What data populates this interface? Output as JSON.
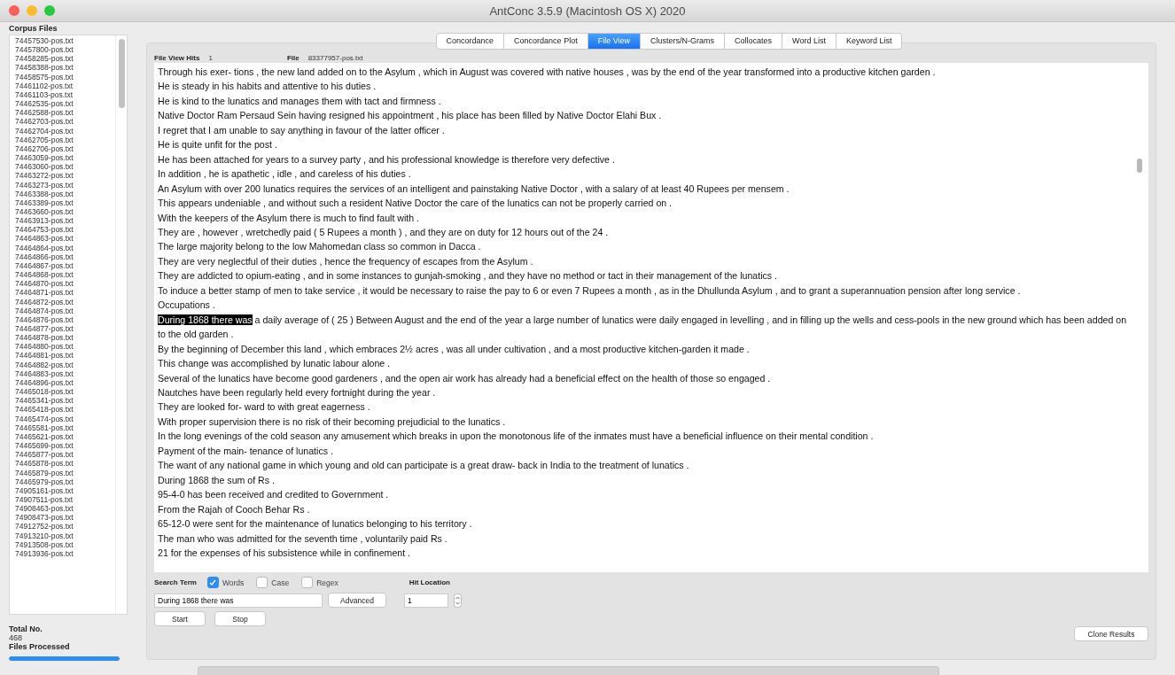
{
  "window": {
    "title": "AntConc 3.5.9 (Macintosh OS X) 2020"
  },
  "sidebar": {
    "title": "Corpus Files",
    "files": [
      "74457530-pos.txt",
      "74457800-pos.txt",
      "74458285-pos.txt",
      "74458388-pos.txt",
      "74458575-pos.txt",
      "74461102-pos.txt",
      "74461103-pos.txt",
      "74462535-pos.txt",
      "74462588-pos.txt",
      "74462703-pos.txt",
      "74462704-pos.txt",
      "74462705-pos.txt",
      "74462706-pos.txt",
      "74463059-pos.txt",
      "74463060-pos.txt",
      "74463272-pos.txt",
      "74463273-pos.txt",
      "74463388-pos.txt",
      "74463389-pos.txt",
      "74463660-pos.txt",
      "74463913-pos.txt",
      "74464753-pos.txt",
      "74464863-pos.txt",
      "74464864-pos.txt",
      "74464866-pos.txt",
      "74464867-pos.txt",
      "74464868-pos.txt",
      "74464870-pos.txt",
      "74464871-pos.txt",
      "74464872-pos.txt",
      "74464874-pos.txt",
      "74464876-pos.txt",
      "74464877-pos.txt",
      "74464878-pos.txt",
      "74464880-pos.txt",
      "74464881-pos.txt",
      "74464882-pos.txt",
      "74464883-pos.txt",
      "74464896-pos.txt",
      "74465018-pos.txt",
      "74465341-pos.txt",
      "74465418-pos.txt",
      "74465474-pos.txt",
      "74465581-pos.txt",
      "74465621-pos.txt",
      "74465699-pos.txt",
      "74465877-pos.txt",
      "74465878-pos.txt",
      "74465879-pos.txt",
      "74465979-pos.txt",
      "74905161-pos.txt",
      "74907511-pos.txt",
      "74908463-pos.txt",
      "74908473-pos.txt",
      "74912752-pos.txt",
      "74913210-pos.txt",
      "74913508-pos.txt",
      "74913936-pos.txt"
    ],
    "total_label": "Total No.",
    "total": "468",
    "processed_label": "Files Processed",
    "progress": {
      "level": 1
    }
  },
  "tabs": [
    {
      "label": "Concordance",
      "selected": false
    },
    {
      "label": "Concordance Plot",
      "selected": false
    },
    {
      "label": "File View",
      "selected": true
    },
    {
      "label": "Clusters/N-Grams",
      "selected": false
    },
    {
      "label": "Collocates",
      "selected": false
    },
    {
      "label": "Word List",
      "selected": false
    },
    {
      "label": "Keyword List",
      "selected": false
    }
  ],
  "header": {
    "hits_label": "File View Hits",
    "hits": "1",
    "file_label": "File",
    "file": "83377957-pos.txt"
  },
  "lines": [
    {
      "text": "Through his exer- tions , the new land added on to the Asylum , which in August was covered with native houses , was by the end of the year transformed into a productive kitchen garden ."
    },
    {
      "text": "He is steady in his habits and attentive to his duties ."
    },
    {
      "text": "He is kind to the lunatics and manages them with tact and firmness ."
    },
    {
      "text": "Native Doctor Ram Persaud Sein having resigned his appointment , his place has been filled by Native Doctor Elahi Bux ."
    },
    {
      "text": "I regret that I am unable to say anything in favour of the latter officer ."
    },
    {
      "text": "He is quite unfit for the post ."
    },
    {
      "text": "He has been attached for years to a survey party , and his professional knowledge is therefore very defective ."
    },
    {
      "text": "In addition , he is apathetic , idle , and careless of his duties ."
    },
    {
      "text": "An Asylum with over 200 lunatics requires the services of an intelligent and painstaking Native Doctor , with a salary of at least 40 Rupees per mensem ."
    },
    {
      "text": "This appears undeniable , and without such a resident Native Doctor the care of the lunatics can not be properly carried on ."
    },
    {
      "text": "With the keepers of the Asylum there is much to find fault with ."
    },
    {
      "text": "They are , however , wretchedly paid ( 5 Rupees a month ) , and they are on duty for 12 hours out of the 24 ."
    },
    {
      "text": "The large majority belong to the low Mahomedan class so common in Dacca ."
    },
    {
      "text": "They are very neglectful of their duties , hence the frequency of escapes from the Asylum ."
    },
    {
      "text": "They are addicted to opium-eating , and in some instances to gunjah-smoking , and they have no method or tact in their management of the lunatics ."
    },
    {
      "text": "To induce a better stamp of men to take service , it would be necessary to raise the pay to 6 or even 7 Rupees a month , as in the Dhullunda Asylum , and to grant a superannuation pension after long service ."
    },
    {
      "text": "Occupations ."
    },
    {
      "hit": "During 1868 there was",
      "text": "a daily average of ( 25 ) Between August and the end of the year a large number of lunatics were daily engaged in levelling , and in filling up the wells and cess-pools in the new ground which has been added on to the old garden ."
    },
    {
      "text": "By the beginning of December this land , which embraces 2½ acres , was all under cultivation , and a most productive kitchen-garden it made ."
    },
    {
      "text": "This change was accomplished by lunatic labour alone ."
    },
    {
      "text": "Several of the lunatics have become good gardeners , and the open air work has already had a beneficial effect on the health of those so engaged ."
    },
    {
      "text": "Nautches have been regularly held every fortnight during the year ."
    },
    {
      "text": "They are looked for- ward to with great eagerness ."
    },
    {
      "text": "With proper supervision there is no risk of their becoming prejudicial to the lunatics ."
    },
    {
      "text": "In the long evenings of the cold season any amusement which breaks in upon the monotonous life of the inmates must have a beneficial influence on their mental condition ."
    },
    {
      "text": "Payment of the main- tenance of lunatics ."
    },
    {
      "text": "The want of any national game in which young and old can participate is a great draw- back in India to the treatment of lunatics ."
    },
    {
      "text": "During 1868 the sum of Rs ."
    },
    {
      "text": "95-4-0 has been received and credited to Government ."
    },
    {
      "text": "From the Rajah of Cooch Behar Rs ."
    },
    {
      "text": "65-12-0 were sent for the maintenance of lunatics belonging to his territory ."
    },
    {
      "text": "The man who was admitted for the seventh time , voluntarily paid Rs ."
    },
    {
      "text": "21 for the expenses of his subsistence while in confinement ."
    }
  ],
  "search": {
    "label": "Search Term",
    "options": [
      {
        "label": "Words",
        "checked": true
      },
      {
        "label": "Case",
        "checked": false
      },
      {
        "label": "Regex",
        "checked": false
      }
    ],
    "value": "During 1868 there was",
    "advanced": "Advanced",
    "hit_location_label": "Hit Location",
    "hit_location": "1",
    "start": "Start",
    "stop": "Stop"
  },
  "clone": "Clone Results"
}
